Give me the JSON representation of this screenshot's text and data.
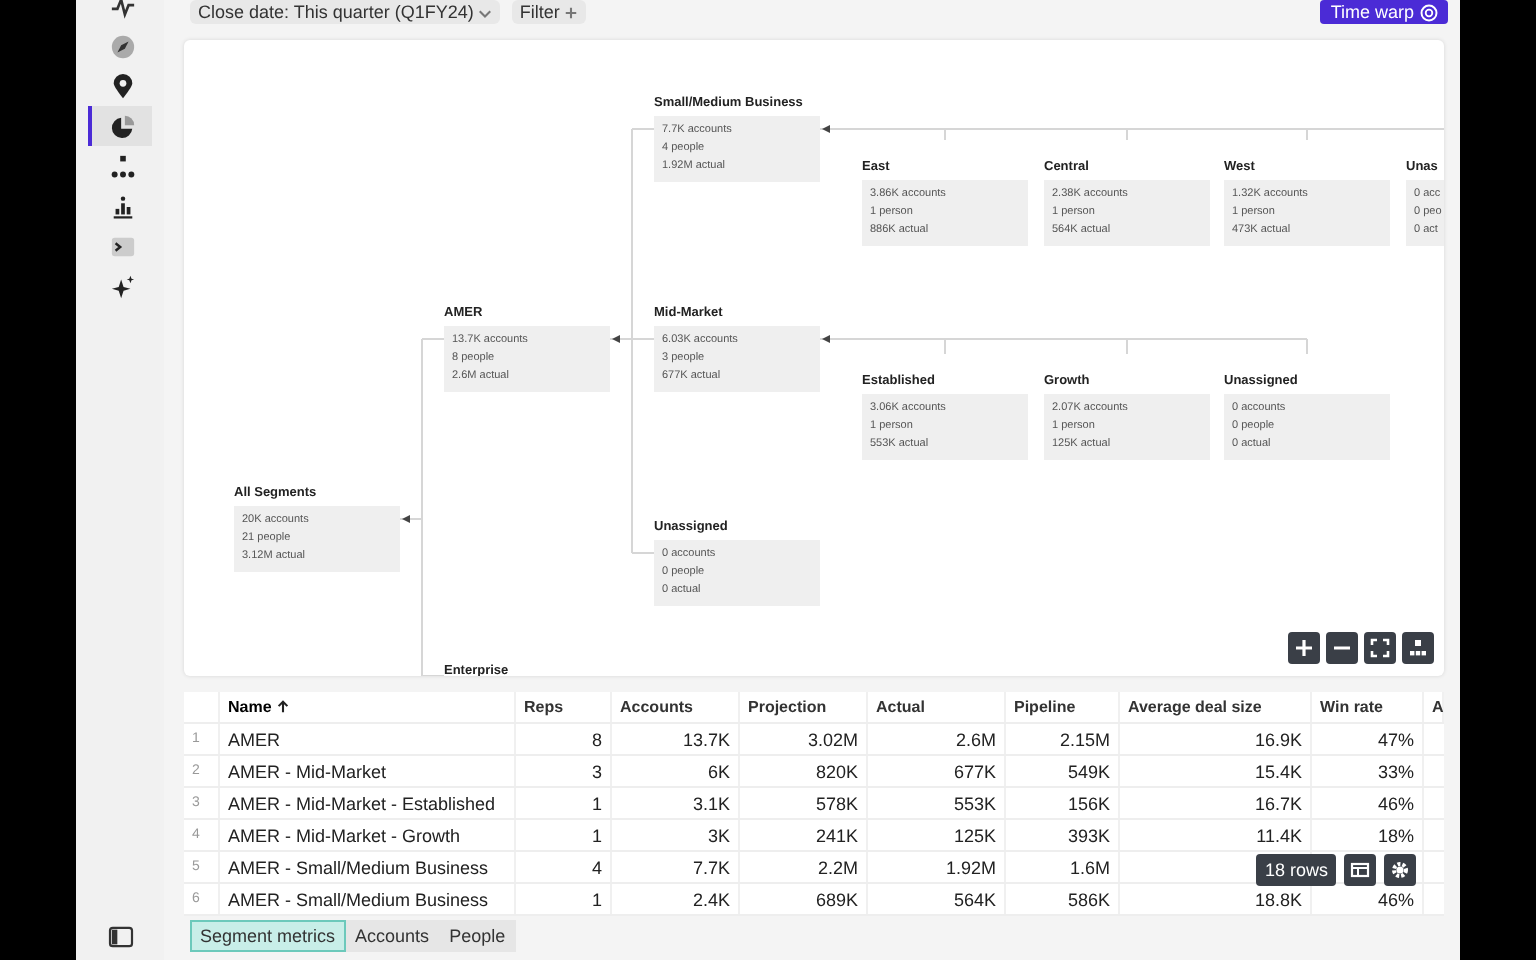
{
  "sidebar": {
    "items": [
      {
        "selected": false
      },
      {
        "selected": false
      },
      {
        "selected": false
      },
      {
        "selected": true
      },
      {
        "selected": false
      },
      {
        "selected": false
      },
      {
        "selected": false
      },
      {
        "selected": false
      }
    ]
  },
  "toolbar": {
    "filters": [
      {
        "label": "Close date: This quarter (Q1FY24)",
        "kind": "dropdown"
      },
      {
        "label": "Filter",
        "kind": "add"
      }
    ],
    "time_warp": "Time warp"
  },
  "tree": {
    "title": "All Segments",
    "stats": [
      "20K accounts",
      "21 people",
      "3.12M actual"
    ],
    "children": [
      {
        "title": "AMER",
        "stats": [
          "13.7K accounts",
          "8 people",
          "2.6M actual"
        ],
        "children": [
          {
            "title": "Small/Medium Business",
            "stats": [
              "7.7K accounts",
              "4 people",
              "1.92M actual"
            ],
            "children": [
              {
                "title": "East",
                "stats": [
                  "3.86K accounts",
                  "1 person",
                  "886K actual"
                ]
              },
              {
                "title": "Central",
                "stats": [
                  "2.38K accounts",
                  "1 person",
                  "564K actual"
                ]
              },
              {
                "title": "West",
                "stats": [
                  "1.32K accounts",
                  "1 person",
                  "473K actual"
                ]
              },
              {
                "title": "Unas",
                "stats": [
                  "0 acc",
                  "0 peo",
                  "0 act"
                ]
              }
            ]
          },
          {
            "title": "Mid-Market",
            "stats": [
              "6.03K accounts",
              "3 people",
              "677K actual"
            ],
            "children": [
              {
                "title": "Established",
                "stats": [
                  "3.06K accounts",
                  "1 person",
                  "553K actual"
                ]
              },
              {
                "title": "Growth",
                "stats": [
                  "2.07K accounts",
                  "1 person",
                  "125K actual"
                ]
              },
              {
                "title": "Unassigned",
                "stats": [
                  "0 accounts",
                  "0 people",
                  "0 actual"
                ]
              }
            ]
          },
          {
            "title": "Unassigned",
            "stats": [
              "0 accounts",
              "0 people",
              "0 actual"
            ]
          }
        ]
      },
      {
        "title": "Enterprise"
      }
    ]
  },
  "table": {
    "columns": [
      {
        "label": "Name",
        "sorted": true
      },
      {
        "label": "Reps",
        "sorted": false
      },
      {
        "label": "Accounts",
        "sorted": false
      },
      {
        "label": "Projection",
        "sorted": false
      },
      {
        "label": "Actual",
        "sorted": false
      },
      {
        "label": "Pipeline",
        "sorted": false
      },
      {
        "label": "Average deal size",
        "sorted": false
      },
      {
        "label": "Win rate",
        "sorted": false
      },
      {
        "label": "A",
        "sorted": false
      }
    ],
    "rows": [
      {
        "index": "1",
        "cells": [
          "AMER",
          "8",
          "13.7K",
          "3.02M",
          "2.6M",
          "2.15M",
          "16.9K",
          "47%"
        ]
      },
      {
        "index": "2",
        "cells": [
          "AMER - Mid-Market",
          "3",
          "6K",
          "820K",
          "677K",
          "549K",
          "15.4K",
          "33%"
        ]
      },
      {
        "index": "3",
        "cells": [
          "AMER - Mid-Market - Established",
          "1",
          "3.1K",
          "578K",
          "553K",
          "156K",
          "16.7K",
          "46%"
        ]
      },
      {
        "index": "4",
        "cells": [
          "AMER - Mid-Market - Growth",
          "1",
          "3K",
          "241K",
          "125K",
          "393K",
          "11.4K",
          "18%"
        ]
      },
      {
        "index": "5",
        "cells": [
          "AMER - Small/Medium Business",
          "4",
          "7.7K",
          "2.2M",
          "1.92M",
          "1.6M",
          null,
          null
        ]
      },
      {
        "index": "6",
        "cells": [
          "AMER - Small/Medium Business",
          "1",
          "2.4K",
          "689K",
          "564K",
          "586K",
          "18.8K",
          "46%"
        ]
      }
    ],
    "row_count": "18 rows"
  },
  "bottom_tabs": [
    {
      "label": "Segment metrics",
      "selected": true
    },
    {
      "label": "Accounts",
      "selected": false
    },
    {
      "label": "People",
      "selected": false
    }
  ]
}
